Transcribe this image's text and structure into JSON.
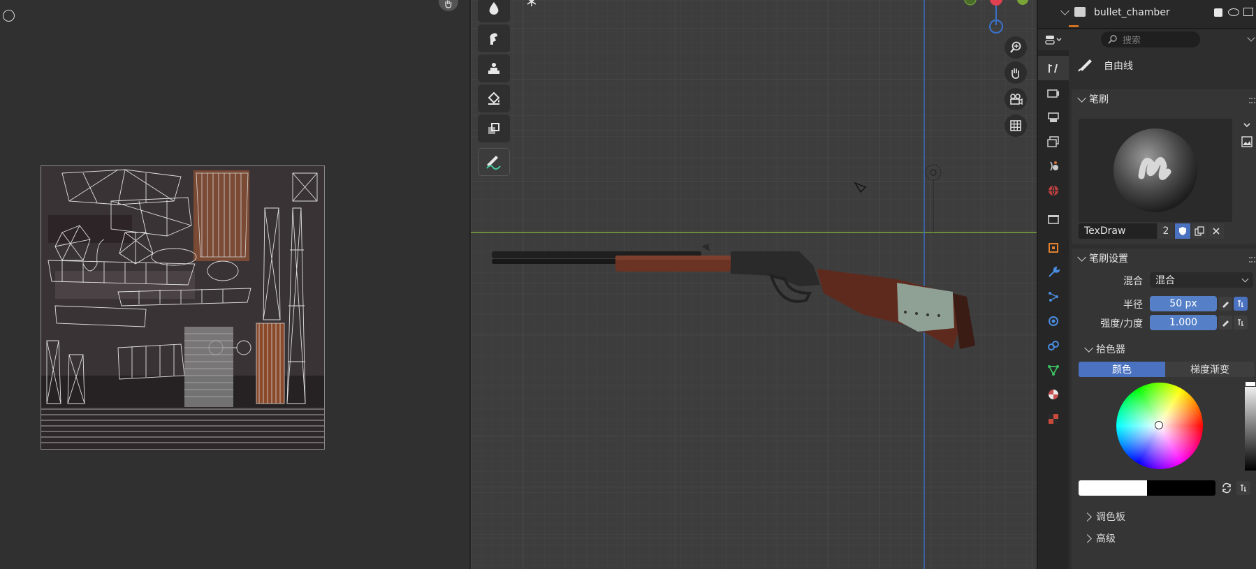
{
  "outliner": {
    "object_name": "bullet_chamber"
  },
  "properties": {
    "search_placeholder": "搜索",
    "tool_name": "自由线",
    "brush_panel": {
      "title": "笔刷",
      "brush_name": "TexDraw",
      "user_count": "2"
    },
    "brush_settings": {
      "title": "笔刷设置",
      "blend_label": "混合",
      "blend_value": "混合",
      "radius_label": "半径",
      "radius_value": "50 px",
      "strength_label": "强度/力度",
      "strength_value": "1.000"
    },
    "color_picker": {
      "title": "拾色器",
      "tab_color": "颜色",
      "tab_gradient": "梯度渐变",
      "primary_color": "#ffffff",
      "secondary_color": "#000000"
    },
    "collapsed_panels": {
      "palette": "调色板",
      "advanced": "高级"
    }
  },
  "colors": {
    "accent": "#4a72c0",
    "viewport_bg": "#3d3d3d",
    "axis_green": "#7aa436",
    "axis_blue": "#3b6fc6"
  },
  "icons": {
    "toolbar": [
      "blur-icon",
      "smear-icon",
      "clone-icon",
      "fill-icon",
      "mask-icon",
      "freehand-draw-icon"
    ],
    "nav": [
      "zoom-icon",
      "pan-hand-icon",
      "camera-icon",
      "ortho-grid-icon"
    ],
    "prop_tabs": [
      "tool-icon",
      "render-icon",
      "output-icon",
      "view-layer-icon",
      "scene-icon",
      "world-icon",
      "collection-icon",
      "object-icon",
      "modifier-icon",
      "particles-icon",
      "physics-icon",
      "constraints-icon",
      "data-icon",
      "material-icon",
      "texture-icon"
    ]
  }
}
